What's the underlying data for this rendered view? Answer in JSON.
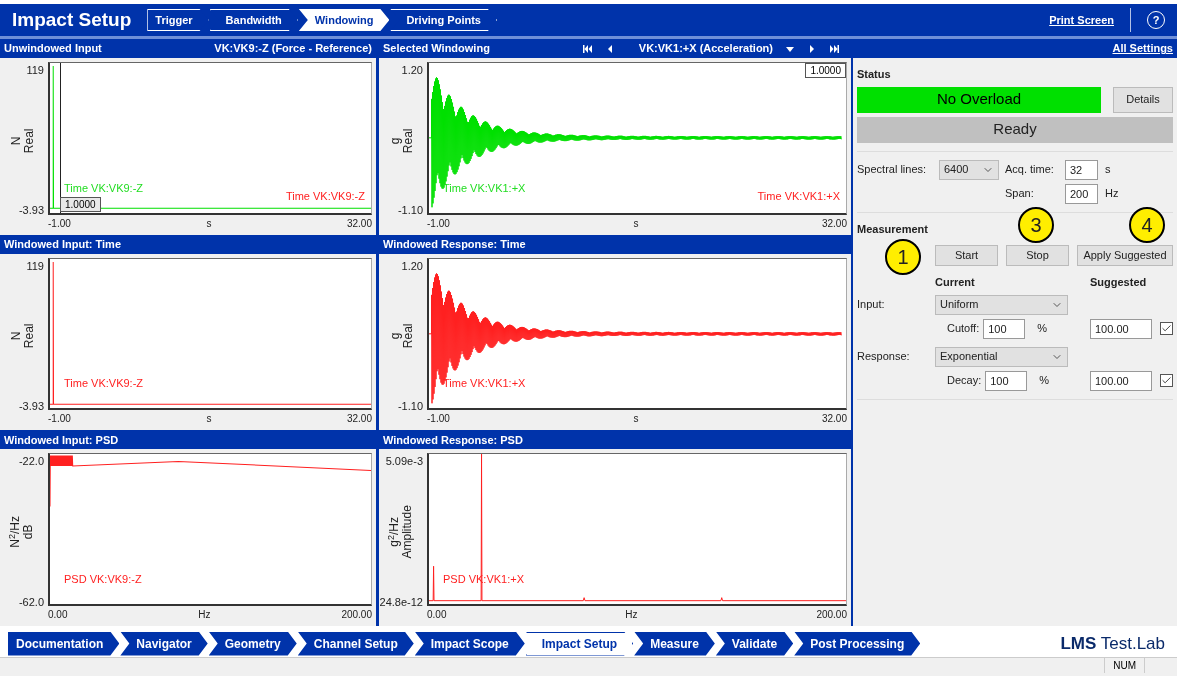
{
  "app_title": "Impact Setup",
  "steps": [
    {
      "label": "Trigger",
      "selected": false
    },
    {
      "label": "Bandwidth",
      "selected": false
    },
    {
      "label": "Windowing",
      "selected": true
    },
    {
      "label": "Driving Points",
      "selected": false
    }
  ],
  "print_screen": "Print Screen",
  "help": "?",
  "panels": [
    {
      "title": "Unwindowed Input",
      "channel": "VK:VK9:-Z (Force - Reference)",
      "kind": "impulse",
      "y_max": "119",
      "y_min": "-3.93",
      "y_unit": "N",
      "y_quantity": "Real",
      "x_min": "-1.00",
      "x_max": "32.00",
      "x_unit": "s",
      "color": "#00e000",
      "marker": {
        "text": "1.0000",
        "kind": "cursor"
      },
      "traces": [
        {
          "label": "Time VK:VK9:-Z",
          "color": "#22dd22"
        },
        {
          "label": "Time VK:VK9:-Z",
          "color": "#ff2020"
        }
      ]
    },
    {
      "title": "Selected Windowing",
      "channel": "VK:VK1:+X (Acceleration)",
      "navigator": true,
      "kind": "decay",
      "y_max": "1.20",
      "y_min": "-1.10",
      "y_unit": "g",
      "y_quantity": "Real",
      "x_min": "-1.00",
      "x_max": "32.00",
      "x_unit": "s",
      "color": "#00e000",
      "marker": {
        "text": "1.0000",
        "kind": "corner"
      },
      "traces": [
        {
          "label": "Time VK:VK1:+X",
          "color": "#22dd22"
        },
        {
          "label": "Time VK:VK1:+X",
          "color": "#ff2020"
        }
      ]
    },
    {
      "title": "Windowed Input: Time",
      "kind": "impulse",
      "y_max": "119",
      "y_min": "-3.93",
      "y_unit": "N",
      "y_quantity": "Real",
      "x_min": "-1.00",
      "x_max": "32.00",
      "x_unit": "s",
      "color": "#ff2020",
      "traces": [
        {
          "label": "Time VK:VK9:-Z",
          "color": "#ff2020"
        }
      ]
    },
    {
      "title": "Windowed Response: Time",
      "kind": "decay",
      "y_max": "1.20",
      "y_min": "-1.10",
      "y_unit": "g",
      "y_quantity": "Real",
      "x_min": "-1.00",
      "x_max": "32.00",
      "x_unit": "s",
      "color": "#ff2020",
      "traces": [
        {
          "label": "Time VK:VK1:+X",
          "color": "#ff2020"
        }
      ]
    },
    {
      "title": "Windowed Input: PSD",
      "kind": "psd_flat",
      "y_max": "-22.0",
      "y_min": "-62.0",
      "y_unit": "N$^{2}$/Hz",
      "y_quantity": "dB",
      "x_min": "0.00",
      "x_max": "200.00",
      "x_unit": "Hz",
      "color": "#ff2020",
      "traces": [
        {
          "label": "PSD VK:VK9:-Z",
          "color": "#ff2020"
        }
      ]
    },
    {
      "title": "Windowed Response: PSD",
      "kind": "psd_spike",
      "y_max": "5.09e-3",
      "y_min": "24.8e-12",
      "y_unit": "g$^{2}$/Hz",
      "y_quantity": "Amplitude",
      "x_min": "0.00",
      "x_max": "200.00",
      "x_unit": "Hz",
      "color": "#ff2020",
      "traces": [
        {
          "label": "PSD VK:VK1:+X",
          "color": "#ff2020"
        }
      ]
    }
  ],
  "all_settings": "All Settings",
  "status": {
    "heading": "Status",
    "overload": false,
    "overload_text": "No Overload",
    "details": "Details",
    "state": "Ready"
  },
  "acquisition": {
    "spectral_lines_label": "Spectral lines:",
    "spectral_lines": "6400",
    "acq_time_label": "Acq. time:",
    "acq_time": "32",
    "acq_time_unit": "s",
    "span_label": "Span:",
    "span": "200",
    "span_unit": "Hz"
  },
  "measurement": {
    "heading": "Measurement",
    "buttons": [
      {
        "label": "Start",
        "callout": "1"
      },
      {
        "label": "Stop",
        "callout": "3"
      },
      {
        "label": "Apply Suggested",
        "callout": "4"
      }
    ],
    "current_heading": "Current",
    "suggested_heading": "Suggested",
    "rows": [
      {
        "label": "Input:",
        "window": "Uniform",
        "param_label": "Cutoff:",
        "param": "100",
        "param_unit": "%",
        "suggested": "100.00",
        "checked": true
      },
      {
        "label": "Response:",
        "window": "Exponential",
        "param_label": "Decay:",
        "param": "100",
        "param_unit": "%",
        "suggested": "100.00",
        "checked": true
      }
    ]
  },
  "workflow": [
    {
      "label": "Documentation",
      "selected": false
    },
    {
      "label": "Navigator",
      "selected": false
    },
    {
      "label": "Geometry",
      "selected": false
    },
    {
      "label": "Channel Setup",
      "selected": false
    },
    {
      "label": "Impact Scope",
      "selected": false
    },
    {
      "label": "Impact Setup",
      "selected": true
    },
    {
      "label": "Measure",
      "selected": false
    },
    {
      "label": "Validate",
      "selected": false
    },
    {
      "label": "Post Processing",
      "selected": false
    }
  ],
  "logo": "**LMS** Test.Lab",
  "status_bar": {
    "indicator": "NUM"
  }
}
